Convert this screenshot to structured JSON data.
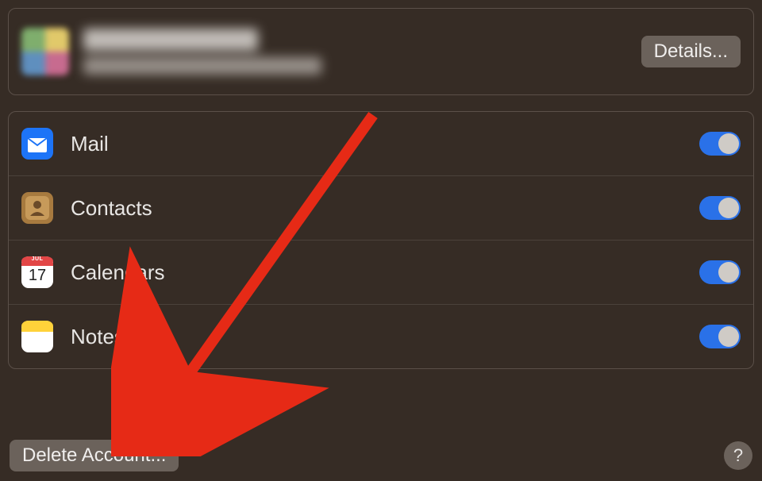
{
  "account": {
    "details_button": "Details..."
  },
  "services": [
    {
      "id": "mail",
      "label": "Mail",
      "enabled": true
    },
    {
      "id": "contacts",
      "label": "Contacts",
      "enabled": true
    },
    {
      "id": "calendars",
      "label": "Calendars",
      "enabled": true
    },
    {
      "id": "notes",
      "label": "Notes",
      "enabled": true
    }
  ],
  "footer": {
    "delete_button": "Delete Account...",
    "help_label": "?"
  },
  "calendar_icon_day": "17",
  "calendar_icon_month": "JUL"
}
